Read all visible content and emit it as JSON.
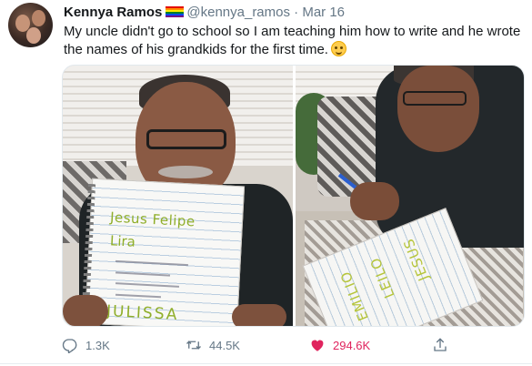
{
  "tweet": {
    "display_name": "Kennya Ramos",
    "handle": "@kennya_ramos",
    "separator": "·",
    "date": "Mar 16",
    "text": "My uncle didn't go to school so I am teaching him how to write and he wrote the names of his grandkids for the first time.",
    "emoji_icon": "smiling-face-emoji"
  },
  "media": {
    "left_photo": {
      "notebook_line1": "Jesus Felipe",
      "notebook_line2": "Lira",
      "notebook_name2": "JULISSA"
    },
    "right_photo": {
      "notebook_word1": "EMILIO",
      "notebook_word2": "LEILO",
      "notebook_word3": "JESUS"
    }
  },
  "actions": {
    "reply_count": "1.3K",
    "retweet_count": "44.5K",
    "like_count": "294.6K",
    "icons": {
      "reply": "reply-icon",
      "retweet": "retweet-icon",
      "like": "heart-icon",
      "share": "share-icon"
    },
    "like_color": "#e0245e"
  },
  "colors": {
    "name": "#14171a",
    "secondary": "#657786",
    "like": "#e0245e"
  }
}
